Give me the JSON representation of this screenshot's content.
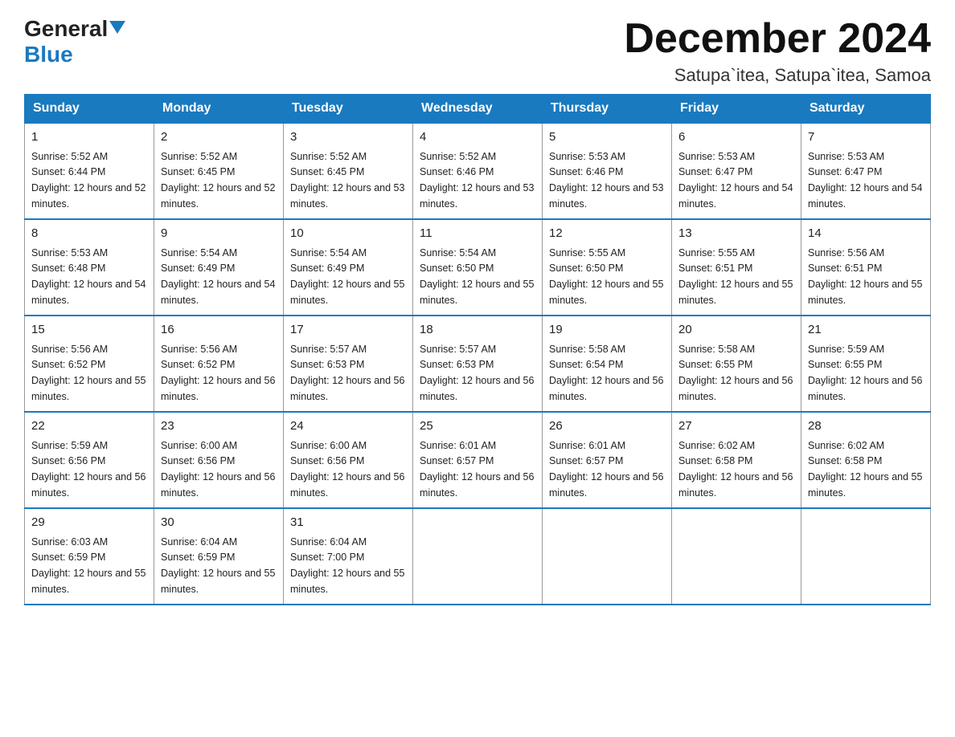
{
  "header": {
    "logo_general": "General",
    "logo_blue": "Blue",
    "month_title": "December 2024",
    "location": "Satupa`itea, Satupa`itea, Samoa"
  },
  "days_of_week": [
    "Sunday",
    "Monday",
    "Tuesday",
    "Wednesday",
    "Thursday",
    "Friday",
    "Saturday"
  ],
  "weeks": [
    [
      {
        "num": "1",
        "sunrise": "5:52 AM",
        "sunset": "6:44 PM",
        "daylight": "12 hours and 52 minutes."
      },
      {
        "num": "2",
        "sunrise": "5:52 AM",
        "sunset": "6:45 PM",
        "daylight": "12 hours and 52 minutes."
      },
      {
        "num": "3",
        "sunrise": "5:52 AM",
        "sunset": "6:45 PM",
        "daylight": "12 hours and 53 minutes."
      },
      {
        "num": "4",
        "sunrise": "5:52 AM",
        "sunset": "6:46 PM",
        "daylight": "12 hours and 53 minutes."
      },
      {
        "num": "5",
        "sunrise": "5:53 AM",
        "sunset": "6:46 PM",
        "daylight": "12 hours and 53 minutes."
      },
      {
        "num": "6",
        "sunrise": "5:53 AM",
        "sunset": "6:47 PM",
        "daylight": "12 hours and 54 minutes."
      },
      {
        "num": "7",
        "sunrise": "5:53 AM",
        "sunset": "6:47 PM",
        "daylight": "12 hours and 54 minutes."
      }
    ],
    [
      {
        "num": "8",
        "sunrise": "5:53 AM",
        "sunset": "6:48 PM",
        "daylight": "12 hours and 54 minutes."
      },
      {
        "num": "9",
        "sunrise": "5:54 AM",
        "sunset": "6:49 PM",
        "daylight": "12 hours and 54 minutes."
      },
      {
        "num": "10",
        "sunrise": "5:54 AM",
        "sunset": "6:49 PM",
        "daylight": "12 hours and 55 minutes."
      },
      {
        "num": "11",
        "sunrise": "5:54 AM",
        "sunset": "6:50 PM",
        "daylight": "12 hours and 55 minutes."
      },
      {
        "num": "12",
        "sunrise": "5:55 AM",
        "sunset": "6:50 PM",
        "daylight": "12 hours and 55 minutes."
      },
      {
        "num": "13",
        "sunrise": "5:55 AM",
        "sunset": "6:51 PM",
        "daylight": "12 hours and 55 minutes."
      },
      {
        "num": "14",
        "sunrise": "5:56 AM",
        "sunset": "6:51 PM",
        "daylight": "12 hours and 55 minutes."
      }
    ],
    [
      {
        "num": "15",
        "sunrise": "5:56 AM",
        "sunset": "6:52 PM",
        "daylight": "12 hours and 55 minutes."
      },
      {
        "num": "16",
        "sunrise": "5:56 AM",
        "sunset": "6:52 PM",
        "daylight": "12 hours and 56 minutes."
      },
      {
        "num": "17",
        "sunrise": "5:57 AM",
        "sunset": "6:53 PM",
        "daylight": "12 hours and 56 minutes."
      },
      {
        "num": "18",
        "sunrise": "5:57 AM",
        "sunset": "6:53 PM",
        "daylight": "12 hours and 56 minutes."
      },
      {
        "num": "19",
        "sunrise": "5:58 AM",
        "sunset": "6:54 PM",
        "daylight": "12 hours and 56 minutes."
      },
      {
        "num": "20",
        "sunrise": "5:58 AM",
        "sunset": "6:55 PM",
        "daylight": "12 hours and 56 minutes."
      },
      {
        "num": "21",
        "sunrise": "5:59 AM",
        "sunset": "6:55 PM",
        "daylight": "12 hours and 56 minutes."
      }
    ],
    [
      {
        "num": "22",
        "sunrise": "5:59 AM",
        "sunset": "6:56 PM",
        "daylight": "12 hours and 56 minutes."
      },
      {
        "num": "23",
        "sunrise": "6:00 AM",
        "sunset": "6:56 PM",
        "daylight": "12 hours and 56 minutes."
      },
      {
        "num": "24",
        "sunrise": "6:00 AM",
        "sunset": "6:56 PM",
        "daylight": "12 hours and 56 minutes."
      },
      {
        "num": "25",
        "sunrise": "6:01 AM",
        "sunset": "6:57 PM",
        "daylight": "12 hours and 56 minutes."
      },
      {
        "num": "26",
        "sunrise": "6:01 AM",
        "sunset": "6:57 PM",
        "daylight": "12 hours and 56 minutes."
      },
      {
        "num": "27",
        "sunrise": "6:02 AM",
        "sunset": "6:58 PM",
        "daylight": "12 hours and 56 minutes."
      },
      {
        "num": "28",
        "sunrise": "6:02 AM",
        "sunset": "6:58 PM",
        "daylight": "12 hours and 55 minutes."
      }
    ],
    [
      {
        "num": "29",
        "sunrise": "6:03 AM",
        "sunset": "6:59 PM",
        "daylight": "12 hours and 55 minutes."
      },
      {
        "num": "30",
        "sunrise": "6:04 AM",
        "sunset": "6:59 PM",
        "daylight": "12 hours and 55 minutes."
      },
      {
        "num": "31",
        "sunrise": "6:04 AM",
        "sunset": "7:00 PM",
        "daylight": "12 hours and 55 minutes."
      },
      null,
      null,
      null,
      null
    ]
  ]
}
